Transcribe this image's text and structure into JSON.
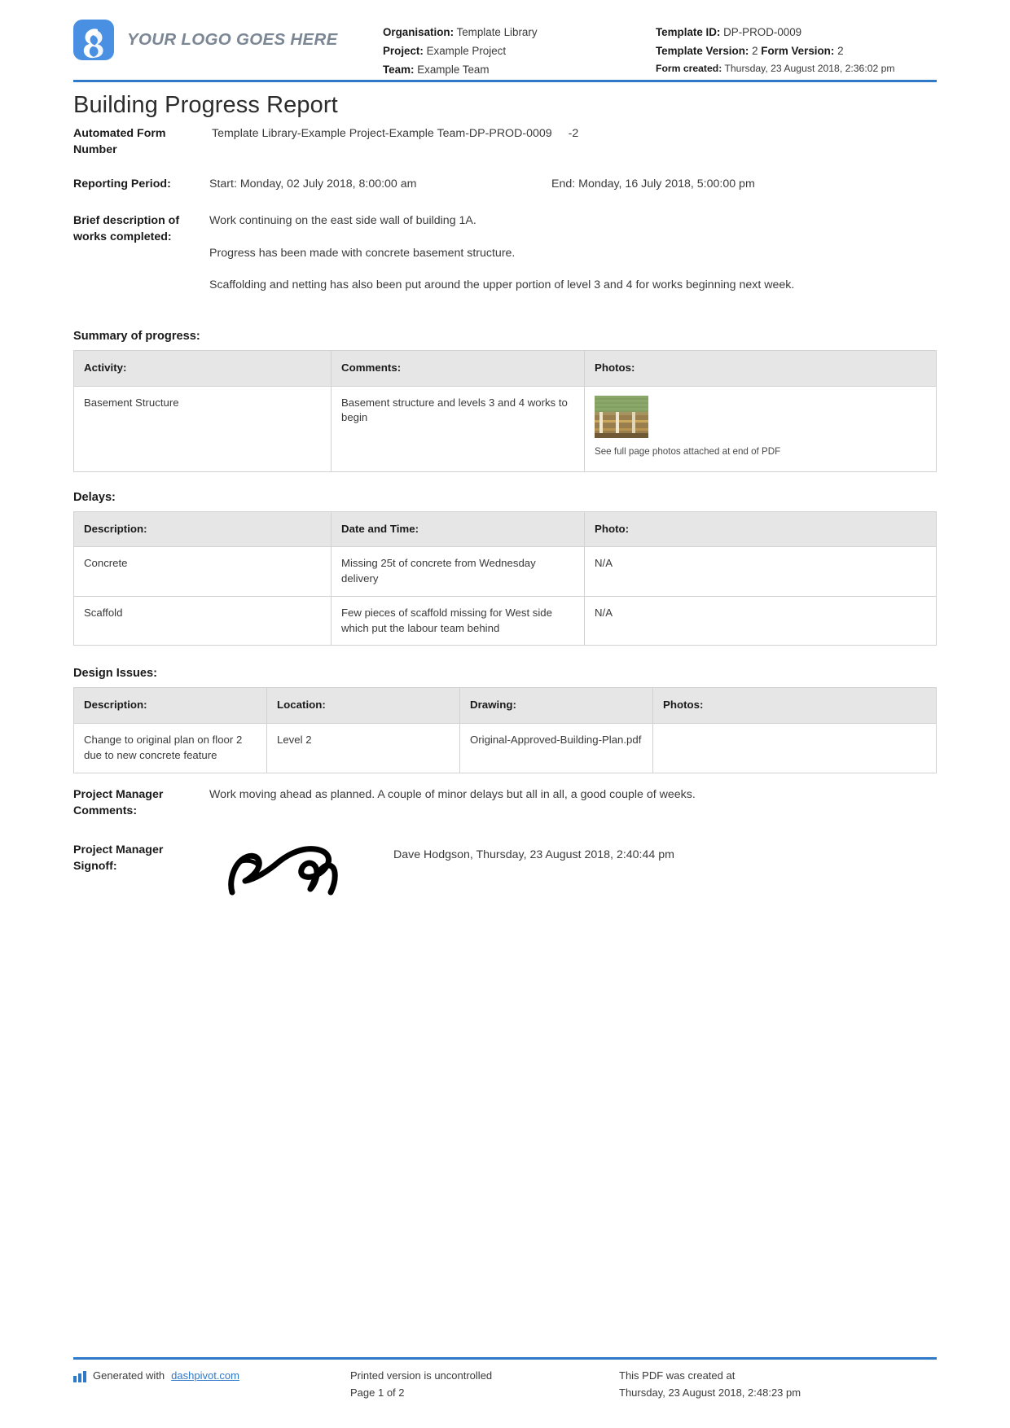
{
  "brand": {
    "accent": "#2f79c9",
    "logo_bg": "#4a90e2",
    "logo_text": "YOUR LOGO GOES HERE"
  },
  "header": {
    "left": [
      {
        "label": "Organisation:",
        "value": "Template Library"
      },
      {
        "label": "Project:",
        "value": "Example Project"
      },
      {
        "label": "Team:",
        "value": "Example Team"
      }
    ],
    "right": {
      "template_id_label": "Template ID:",
      "template_id_value": "DP-PROD-0009",
      "template_version_label": "Template Version:",
      "template_version_value": "2",
      "form_version_label": "Form Version:",
      "form_version_value": "2",
      "form_created_label": "Form created:",
      "form_created_value": "Thursday, 23 August 2018, 2:36:02 pm"
    }
  },
  "title": "Building Progress Report",
  "fields": {
    "form_number_label": "Automated Form Number",
    "form_number_value": "Template Library-Example Project-Example Team-DP-PROD-0009",
    "form_number_suffix": "-2",
    "reporting_label": "Reporting Period:",
    "reporting_start": "Start: Monday, 02 July 2018, 8:00:00 am",
    "reporting_end": "End: Monday, 16 July 2018, 5:00:00 pm",
    "brief_label": "Brief description of works completed:",
    "brief_p1": "Work continuing on the east side wall of building 1A.",
    "brief_p2": "Progress has been made with concrete basement structure.",
    "brief_p3": "Scaffolding and netting has also been put around the upper portion of level 3 and 4 for works beginning next week."
  },
  "summary": {
    "heading": "Summary of progress:",
    "columns": [
      "Activity:",
      "Comments:",
      "Photos:"
    ],
    "rows": [
      {
        "activity": "Basement Structure",
        "comments": "Basement structure and levels 3 and 4 works to begin",
        "photo_caption": "See full page photos attached at end of PDF"
      }
    ]
  },
  "delays": {
    "heading": "Delays:",
    "columns": [
      "Description:",
      "Date and Time:",
      "Photo:"
    ],
    "rows": [
      {
        "description": "Concrete",
        "date_time": "Missing 25t of concrete from Wednesday delivery",
        "photo": "N/A"
      },
      {
        "description": "Scaffold",
        "date_time": "Few pieces of scaffold missing for West side which put the labour team behind",
        "photo": "N/A"
      }
    ]
  },
  "design_issues": {
    "heading": "Design Issues:",
    "columns": [
      "Description:",
      "Location:",
      "Drawing:",
      "Photos:"
    ],
    "rows": [
      {
        "description": "Change to original plan on floor 2 due to new concrete feature",
        "location": "Level 2",
        "drawing": "Original-Approved-Building-Plan.pdf",
        "photos": ""
      }
    ]
  },
  "signoff": {
    "comments_label": "Project Manager Comments:",
    "comments_value": "Work moving ahead as planned. A couple of minor delays but all in all, a good couple of weeks.",
    "signoff_label": "Project Manager Signoff:",
    "signoff_name": "Dave Hodgson, Thursday, 23 August 2018, 2:40:44 pm"
  },
  "footer": {
    "generated_prefix": "Generated with",
    "generated_link": "dashpivot.com",
    "uncontrolled": "Printed version is uncontrolled",
    "page": "Page 1 of 2",
    "created_at_label": "This PDF was created at",
    "created_at_value": "Thursday, 23 August 2018, 2:48:23 pm"
  }
}
